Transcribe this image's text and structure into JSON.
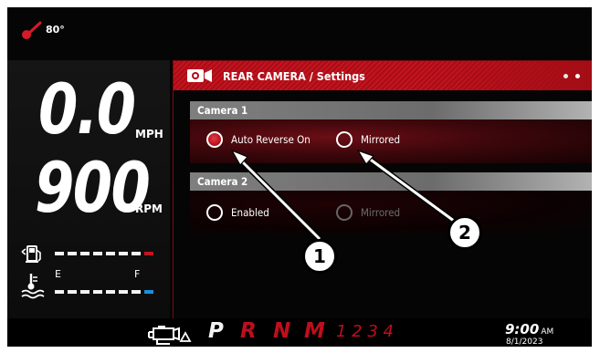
{
  "status": {
    "temperature": "80°",
    "speed": "0.0",
    "speed_unit": "MPH",
    "rpm": "900",
    "rpm_unit": "RPM",
    "gauge_empty": "E",
    "gauge_full": "F",
    "fuel_bar_segments": 8,
    "coolant_bar_segments": 8
  },
  "panel": {
    "title": "REAR CAMERA / Settings",
    "page_count": 2
  },
  "camera1": {
    "label": "Camera 1",
    "options": [
      {
        "label": "Auto Reverse On",
        "selected": true,
        "enabled": true
      },
      {
        "label": "Mirrored",
        "selected": false,
        "enabled": true
      }
    ]
  },
  "camera2": {
    "label": "Camera 2",
    "options": [
      {
        "label": "Enabled",
        "selected": false,
        "enabled": true
      },
      {
        "label": "Mirrored",
        "selected": false,
        "enabled": false
      }
    ]
  },
  "bottom": {
    "gears": {
      "p": "P",
      "r": "R",
      "n": "N",
      "m": "M",
      "nums": "1 2 3 4"
    },
    "time": "9:00",
    "ampm": "AM",
    "date": "8/1/2023"
  },
  "callouts": {
    "one": "1",
    "two": "2"
  },
  "colors": {
    "accent_red": "#c4141f",
    "section_gray": "#7f7f7f",
    "fuel_low": "#c4141f",
    "coolant_cold": "#1d8ee0"
  }
}
